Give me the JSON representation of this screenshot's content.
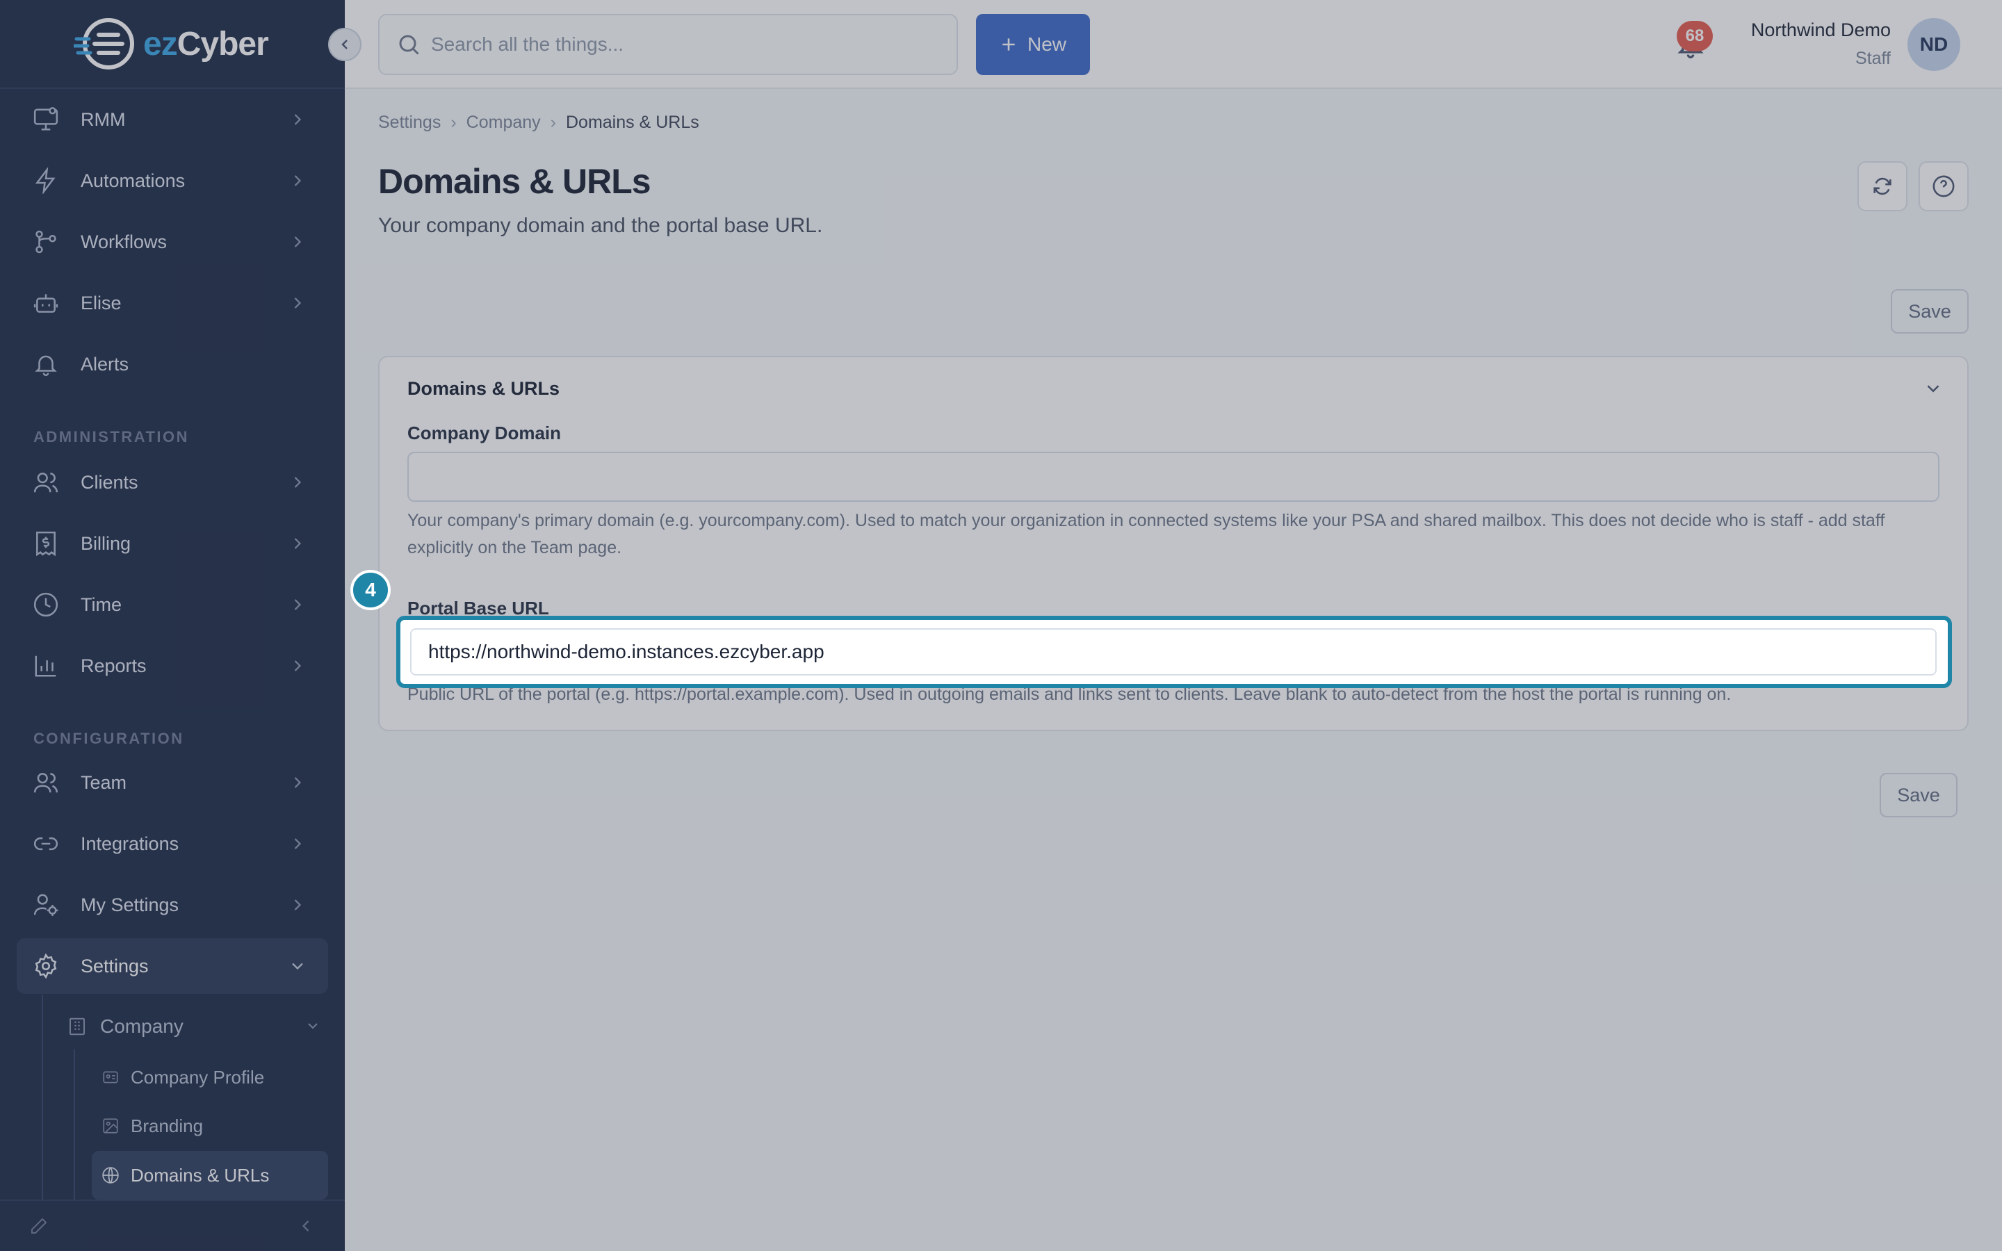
{
  "brand": {
    "logo_text_a": "ez",
    "logo_text_b": "Cyber"
  },
  "sidebar": {
    "items": [
      {
        "label": "RMM",
        "icon": "monitor-icon"
      },
      {
        "label": "Automations",
        "icon": "bolt-icon"
      },
      {
        "label": "Workflows",
        "icon": "workflow-icon"
      },
      {
        "label": "Elise",
        "icon": "bot-icon"
      },
      {
        "label": "Alerts",
        "icon": "bell-icon"
      }
    ],
    "admin_section": "ADMINISTRATION",
    "admin_items": [
      {
        "label": "Clients",
        "icon": "users-icon"
      },
      {
        "label": "Billing",
        "icon": "receipt-icon"
      },
      {
        "label": "Time",
        "icon": "clock-icon"
      },
      {
        "label": "Reports",
        "icon": "chart-icon"
      }
    ],
    "config_section": "CONFIGURATION",
    "config_items": [
      {
        "label": "Team",
        "icon": "users-icon"
      },
      {
        "label": "Integrations",
        "icon": "link-icon"
      },
      {
        "label": "My Settings",
        "icon": "user-gear-icon"
      },
      {
        "label": "Settings",
        "icon": "gear-icon"
      }
    ],
    "settings_sub": {
      "company": "Company",
      "company_profile": "Company Profile",
      "branding": "Branding",
      "domains": "Domains & URLs"
    }
  },
  "topbar": {
    "search_placeholder": "Search all the things...",
    "new_label": "New",
    "notification_count": "68",
    "user_name": "Northwind Demo",
    "user_role": "Staff",
    "avatar_initials": "ND"
  },
  "breadcrumb": {
    "a": "Settings",
    "b": "Company",
    "c": "Domains & URLs"
  },
  "page": {
    "title": "Domains & URLs",
    "subtitle": "Your company domain and the portal base URL.",
    "save_label": "Save"
  },
  "card": {
    "title": "Domains & URLs",
    "company_domain_label": "Company Domain",
    "company_domain_value": "",
    "company_domain_help": "Your company's primary domain (e.g. yourcompany.com). Used to match your organization in connected systems like your PSA and shared mailbox. This does not decide who is staff - add staff explicitly on the Team page.",
    "portal_url_label": "Portal Base URL",
    "portal_url_value": "https://northwind-demo.instances.ezcyber.app",
    "portal_url_help": "Public URL of the portal (e.g. https://portal.example.com). Used in outgoing emails and links sent to clients. Leave blank to auto-detect from the host the portal is running on."
  },
  "overlay": {
    "step_number": "4"
  },
  "colors": {
    "sidebar_bg": "#1d2a47",
    "primary": "#3c68c9",
    "highlight": "#1f86a8",
    "badge": "#e55a4f"
  }
}
